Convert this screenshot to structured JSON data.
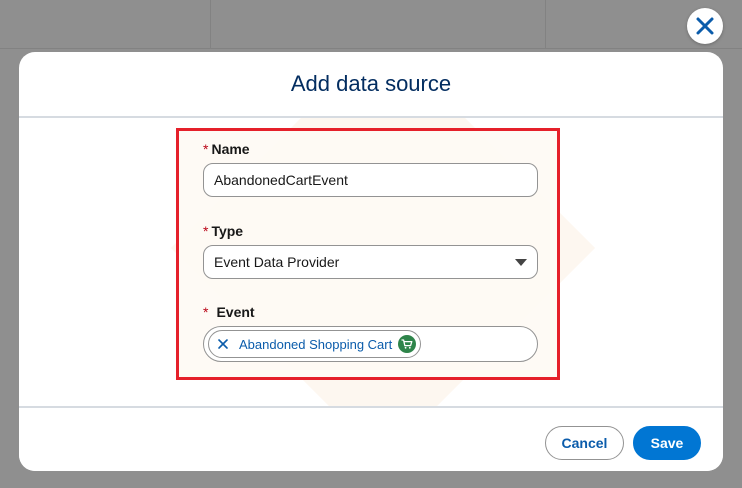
{
  "modal": {
    "title": "Add data source"
  },
  "form": {
    "required_marker": "*",
    "name": {
      "label": "Name",
      "value": "AbandonedCartEvent"
    },
    "type": {
      "label": "Type",
      "selected": "Event Data Provider"
    },
    "event": {
      "label": "Event",
      "pill_label": "Abandoned Shopping Cart",
      "pill_icon": "cart-icon"
    }
  },
  "footer": {
    "cancel_label": "Cancel",
    "save_label": "Save"
  },
  "colors": {
    "brand_blue": "#0176d3",
    "link_blue": "#0b5cab",
    "title_navy": "#032d60",
    "highlight_red": "#e5202a",
    "cart_green": "#2e844a"
  },
  "icons": {
    "close": "close-icon",
    "dropdown": "chevron-down-icon",
    "pill_remove": "remove-icon"
  }
}
